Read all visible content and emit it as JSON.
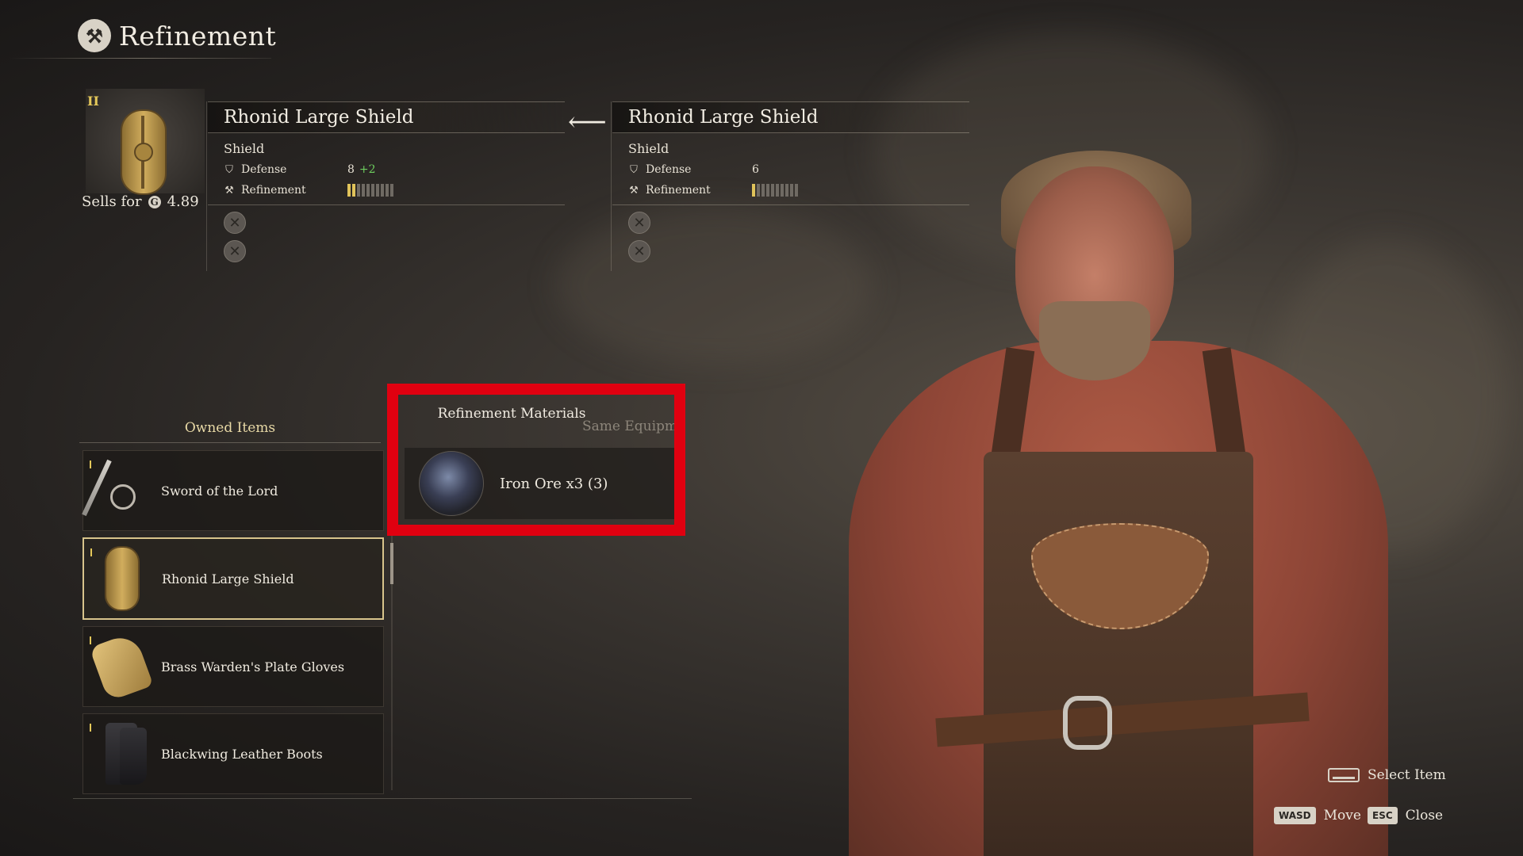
{
  "header": {
    "title": "Refinement",
    "emblem_icon": "anvil-hammer-icon"
  },
  "item_preview": {
    "tier_mark": "II",
    "sells_label": "Sells for",
    "sells_value": "4.89",
    "currency_icon": "gold-coin-icon"
  },
  "refined_panel": {
    "name": "Rhonid Large Shield",
    "type": "Shield",
    "defense_label": "Defense",
    "defense_value": "8",
    "defense_bonus": "+2",
    "refinement_label": "Refinement",
    "refinement_level": 2,
    "refinement_max": 10
  },
  "current_panel": {
    "name": "Rhonid Large Shield",
    "type": "Shield",
    "defense_label": "Defense",
    "defense_value": "6",
    "refinement_label": "Refinement",
    "refinement_level": 1,
    "refinement_max": 10
  },
  "owned": {
    "tab_label": "Owned Items",
    "items": [
      {
        "label": "Sword of the Lord",
        "icon": "sword-icon",
        "selected": false
      },
      {
        "label": "Rhonid Large Shield",
        "icon": "shield-icon",
        "selected": true
      },
      {
        "label": "Brass Warden's Plate Gloves",
        "icon": "gloves-icon",
        "selected": false
      },
      {
        "label": "Blackwing Leather Boots",
        "icon": "boots-icon",
        "selected": false
      }
    ]
  },
  "materials": {
    "tab_label": "Refinement Materials",
    "other_tab_label": "Same Equipme",
    "items": [
      {
        "label": "Iron Ore x3 (3)",
        "icon": "iron-ore-icon"
      }
    ]
  },
  "highlight_color": "#e00010",
  "hints": {
    "select_label": "Select Item",
    "move_key": "WASD",
    "move_label": "Move",
    "close_key": "ESC",
    "close_label": "Close"
  }
}
